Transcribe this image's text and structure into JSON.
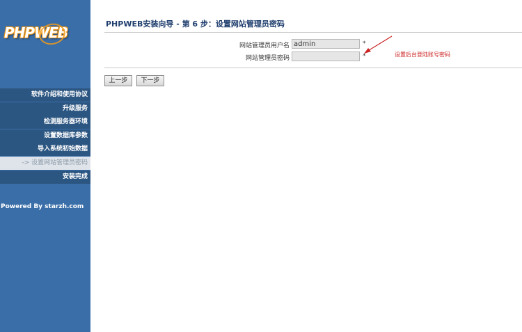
{
  "sidebar": {
    "logo_text": "PHPWEB",
    "items": [
      {
        "label": "软件介绍和使用协议",
        "active": false
      },
      {
        "label": "升级服务",
        "active": false
      },
      {
        "label": "检测服务器环境",
        "active": false
      },
      {
        "label": "设置数据库参数",
        "active": false
      },
      {
        "label": "导入系统初始数据",
        "active": false
      },
      {
        "label": "-> 设置网站管理员密码",
        "active": true
      },
      {
        "label": "安装完成",
        "active": false
      }
    ],
    "powered_by": "Powered By starzh.com"
  },
  "main": {
    "title": "PHPWEB安装向导 - 第 6 步：设置网站管理员密码",
    "form": {
      "username_label": "网站管理员用户名",
      "username_value": "admin",
      "password_label": "网站管理员密码",
      "password_value": "",
      "required_mark": "*"
    },
    "hint": "设置后台登陆账号密码",
    "buttons": {
      "prev": "上一步",
      "next": "下一步"
    }
  },
  "colors": {
    "sidebar_bg": "#3a6ea8",
    "menu_item_bg": "#2c5682",
    "active_item_bg": "#dfe4ea",
    "title_color": "#1f3e6e",
    "hint_color": "#cc2222",
    "logo_accent": "#f29a1a"
  }
}
